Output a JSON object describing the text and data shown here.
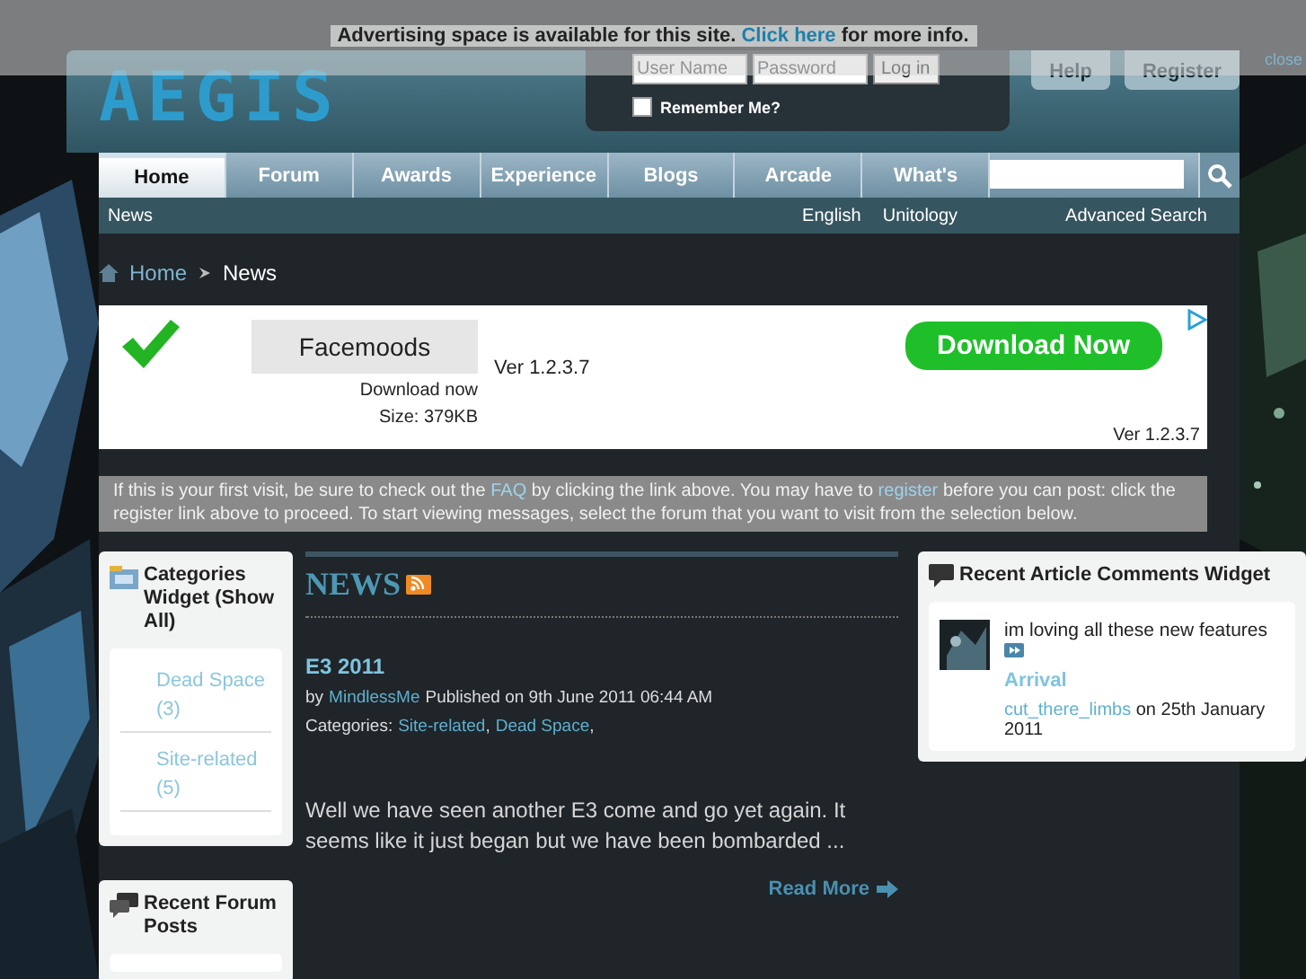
{
  "ad_bar": {
    "text_before": "Advertising space is available for this site.",
    "link": "Click here",
    "text_after": "for more info.",
    "close": "close"
  },
  "header": {
    "logo": "AEGIS",
    "username_placeholder": "User Name",
    "password_placeholder": "Password",
    "login_button": "Log in",
    "remember_label": "Remember Me?",
    "remember_checked": false,
    "buttons": [
      "Help",
      "Register"
    ]
  },
  "nav": {
    "tabs": [
      {
        "label": "Home",
        "selected": true
      },
      {
        "label": "Forum",
        "selected": false
      },
      {
        "label": "Awards",
        "selected": false
      },
      {
        "label": "Experience",
        "selected": false
      },
      {
        "label": "Blogs",
        "selected": false
      },
      {
        "label": "Arcade",
        "selected": false
      },
      {
        "label": "What's",
        "selected": false
      }
    ]
  },
  "subnav": {
    "left": [
      "News"
    ],
    "right": [
      "English",
      "Unitology",
      "Advanced Search"
    ]
  },
  "breadcrumb": [
    "Home",
    "News"
  ],
  "ad": {
    "product": "Facemoods",
    "version": "Ver 1.2.3.7",
    "download_text": "Download now",
    "size": "Size: 379KB",
    "button": "Download Now",
    "footer_version": "Ver 1.2.3.7"
  },
  "notice": [
    {
      "text": "If this is your first visit, be sure to check out the",
      "link": false
    },
    {
      "text": "FAQ",
      "link": true
    },
    {
      "text": "by clicking the link above. You may have to",
      "link": false
    },
    {
      "text": "register",
      "link": true
    },
    {
      "text": "before you can post: click the register link above to proceed. To start viewing messages, select the forum that you want to visit from the selection below.",
      "link": false
    }
  ],
  "categories_widget": {
    "title": "Categories Widget (Show All)",
    "items": [
      "Dead Space (3)",
      "Site-related (5)"
    ]
  },
  "news": {
    "title": "NEWS",
    "articles": [
      {
        "title": "E3 2011",
        "by": "by",
        "author": "MindlessMe",
        "published": "Published on 9th June 2011 06:44 AM",
        "categories_label": "Categories:",
        "categories": [
          "Site-related",
          "Dead Space"
        ],
        "separator": ",",
        "excerpt": "Well we have seen another E3 come and go yet again. It seems like it just began but we have been bombarded ...",
        "read_more": "Read More"
      }
    ]
  },
  "recent_forum_posts": {
    "title": "Recent Forum Posts"
  },
  "comments_widget": {
    "title": "Recent Article Comments Widget",
    "comments": [
      {
        "text": "im loving all these new features",
        "article": "Arrival",
        "user": "cut_there_limbs",
        "date": "on 25th January 2011"
      }
    ]
  }
}
